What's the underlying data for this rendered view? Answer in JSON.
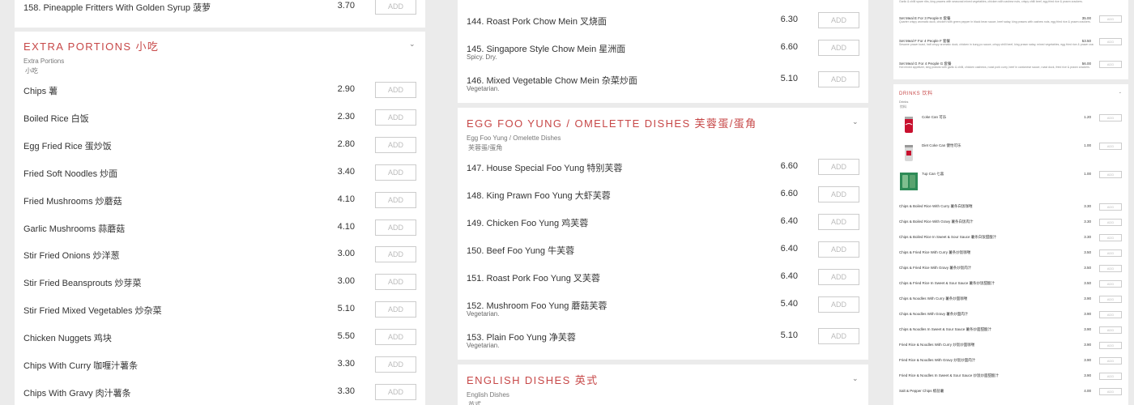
{
  "top_item": {
    "name": "158. Pineapple Fritters With Golden Syrup 菠萝",
    "price": "3.70",
    "add": "ADD"
  },
  "extra": {
    "title": "EXTRA PORTIONS 小吃",
    "sub1": "Extra Portions",
    "sub2": "小吃",
    "items": [
      {
        "name": "Chips 薯",
        "price": "2.90",
        "add": "ADD"
      },
      {
        "name": "Boiled Rice 白饭",
        "price": "2.30",
        "add": "ADD"
      },
      {
        "name": "Egg Fried Rice 蛋炒饭",
        "price": "2.80",
        "add": "ADD"
      },
      {
        "name": "Fried Soft Noodles 炒面",
        "price": "3.40",
        "add": "ADD"
      },
      {
        "name": "Fried Mushrooms 炒蘑菇",
        "price": "4.10",
        "add": "ADD"
      },
      {
        "name": "Garlic Mushrooms 蒜蘑菇",
        "price": "4.10",
        "add": "ADD"
      },
      {
        "name": "Stir Fried Onions 炒洋葱",
        "price": "3.00",
        "add": "ADD"
      },
      {
        "name": "Stir Fried Beansprouts 炒芽菜",
        "price": "3.00",
        "add": "ADD"
      },
      {
        "name": "Stir Fried Mixed Vegetables 炒杂菜",
        "price": "5.10",
        "add": "ADD"
      },
      {
        "name": "Chicken Nuggets 鸡块",
        "price": "5.50",
        "add": "ADD"
      },
      {
        "name": "Chips With Curry 咖喱汁薯条",
        "price": "3.30",
        "add": "ADD"
      },
      {
        "name": "Chips With Gravy 肉汁薯条",
        "price": "3.30",
        "add": "ADD"
      }
    ]
  },
  "chowmein": [
    {
      "name": "144. Roast Pork Chow Mein 叉烧面",
      "desc": "",
      "price": "6.30",
      "add": "ADD"
    },
    {
      "name": "145. Singapore Style Chow Mein 星洲面",
      "desc": "Spicy. Dry.",
      "price": "6.60",
      "add": "ADD"
    },
    {
      "name": "146. Mixed Vegetable Chow Mein 杂菜炒面",
      "desc": "Vegetarian.",
      "price": "5.10",
      "add": "ADD"
    }
  ],
  "eggfoo": {
    "title": "EGG FOO YUNG / OMELETTE DISHES 芙蓉蛋/蛋角",
    "sub1": "Egg Foo Yung / Omelette Dishes",
    "sub2": "芙蓉蛋/蛋角",
    "items": [
      {
        "name": "147. House Special Foo Yung 特别芙蓉",
        "desc": "",
        "price": "6.60",
        "add": "ADD"
      },
      {
        "name": "148. King Prawn Foo Yung 大虾芙蓉",
        "desc": "",
        "price": "6.60",
        "add": "ADD"
      },
      {
        "name": "149. Chicken Foo Yung 鸡芙蓉",
        "desc": "",
        "price": "6.40",
        "add": "ADD"
      },
      {
        "name": "150. Beef Foo Yung 牛芙蓉",
        "desc": "",
        "price": "6.40",
        "add": "ADD"
      },
      {
        "name": "151. Roast Pork Foo Yung 叉芙蓉",
        "desc": "",
        "price": "6.40",
        "add": "ADD"
      },
      {
        "name": "152. Mushroom Foo Yung 蘑菇芙蓉",
        "desc": "Vegetarian.",
        "price": "5.40",
        "add": "ADD"
      },
      {
        "name": "153. Plain Foo Yung 净芙蓉",
        "desc": "Vegetarian.",
        "price": "5.10",
        "add": "ADD"
      }
    ]
  },
  "english": {
    "title": "ENGLISH DISHES 英式",
    "sub1": "English Dishes",
    "sub2": "英式"
  },
  "setmeals": [
    {
      "name": "Set Meal E For 3 People E 套餐",
      "desc": "Quarter crispy aromatic duck, chicken with green pepper in black bean sauce, beef satay, king prawns with cashew nuts, egg fried rice & prawn crackers.",
      "price": "35.00",
      "add": "ADD"
    },
    {
      "name": "Set Meal F For 4 People F 套餐",
      "desc": "Sesame prawn toast, half crispy aromatic duck, chicken in kung po sauce, crispy chilli beef, king prawn satay, mixed vegetables, egg fried rice & prawn crackers.",
      "price": "53.50",
      "add": "ADD"
    },
    {
      "name": "Set Meal G For 4 People G 套餐",
      "desc": "Hot mixed appetizer, king prawns with garlic & chilli, chicken cashews, roast pork curry, beef in cantonese sauce, roast duck, fried rice & prawn crackers.",
      "price": "56.00",
      "add": "ADD"
    }
  ],
  "setmeal_top_desc": "Garlic & chilli spare ribs, king prawns with seasonal mixed vegetables, chicken with cashew nuts, crispy chilli beef, egg fried rice & prawn crackers.",
  "drinks": {
    "title": "DRINKS 饮料",
    "sub1": "Drinks",
    "sub2": "饮料",
    "items": [
      {
        "name": "Coke Can 可乐",
        "price": "1.20",
        "add": "ADD"
      },
      {
        "name": "Diet Coke Can 健怡可乐",
        "price": "1.00",
        "add": "ADD"
      },
      {
        "name": "7up Can 七喜",
        "price": "1.00",
        "add": "ADD"
      }
    ]
  },
  "combos": [
    {
      "name": "Chips & Boiled Rice With Curry 薯条白饭咖喱",
      "price": "3.30",
      "add": "ADD"
    },
    {
      "name": "Chips & Boiled Rice With Gravy 薯条白饭肉汁",
      "price": "3.30",
      "add": "ADD"
    },
    {
      "name": "Chips & Boiled Rice In Sweet & Sour Sauce 薯条白饭甜酸汁",
      "price": "3.30",
      "add": "ADD"
    },
    {
      "name": "Chips & Fried Rice With Curry 薯条炒饭咖喱",
      "price": "3.50",
      "add": "ADD"
    },
    {
      "name": "Chips & Fried Rice With Gravy 薯条炒饭肉汁",
      "price": "3.50",
      "add": "ADD"
    },
    {
      "name": "Chips & Fried Rice In Sweet & Sour Sauce 薯条炒饭甜酸汁",
      "price": "3.50",
      "add": "ADD"
    },
    {
      "name": "Chips & Noodles With Curry 薯条炒面咖喱",
      "price": "3.90",
      "add": "ADD"
    },
    {
      "name": "Chips & Noodles With Gravy 薯条炒面肉汁",
      "price": "3.90",
      "add": "ADD"
    },
    {
      "name": "Chips & Noodles In Sweet & Sour Sauce 薯条炒面甜酸汁",
      "price": "3.90",
      "add": "ADD"
    },
    {
      "name": "Fried Rice & Noodles With Curry 炒饭炒面咖喱",
      "price": "3.90",
      "add": "ADD"
    },
    {
      "name": "Fried Rice & Noodles With Gravy 炒饭炒面肉汁",
      "price": "3.90",
      "add": "ADD"
    },
    {
      "name": "Fried Rice & Noodles In Sweet & Sour Sauce 炒饭炒面甜酸汁",
      "price": "3.90",
      "add": "ADD"
    },
    {
      "name": "Salt & Pepper Chips 椒盐薯",
      "price": "4.00",
      "add": "ADD"
    }
  ],
  "colors": {
    "accent": "#c74848",
    "page_bg": "#ebebeb",
    "card_bg": "#ffffff"
  },
  "icons": {
    "chevron": "chevron-down-icon",
    "coke": "coke-can-icon",
    "diet": "diet-coke-can-icon",
    "sevenup": "7up-can-icon"
  }
}
